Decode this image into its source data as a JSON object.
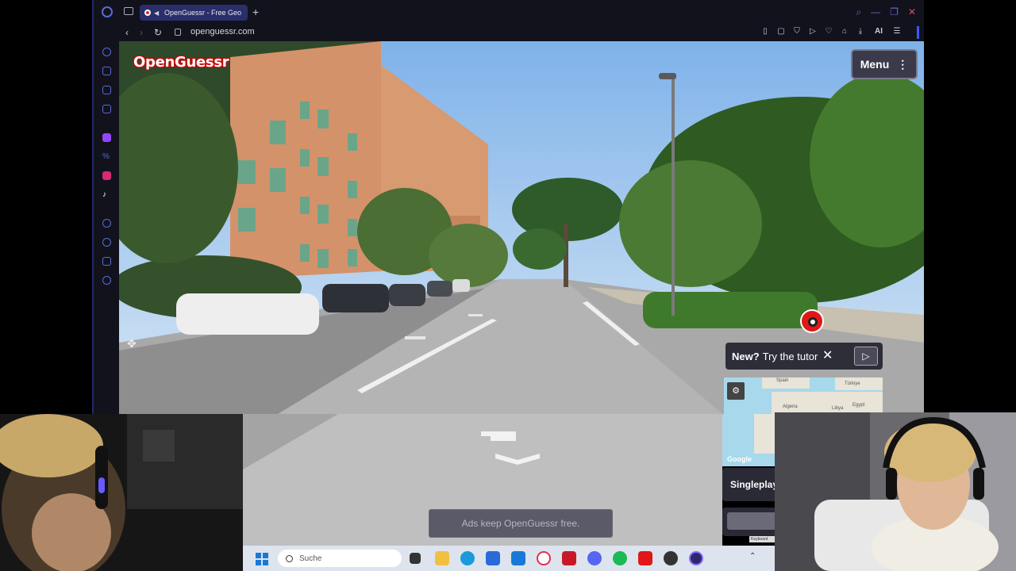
{
  "browser": {
    "tab_title": "OpenGuessr - Free Geo",
    "new_tab_label": "+",
    "url": "openguessr.com",
    "ai_label": "AI",
    "nav": {
      "back": "‹",
      "forward": "›",
      "reload": "↻"
    }
  },
  "game": {
    "logo_text": "OpenGuessr",
    "menu_label": "Menu",
    "tutorial_bold": "New?",
    "tutorial_text": "Try the tutor",
    "tutorial_close": "✕",
    "tutorial_play": "▷",
    "map_labels": [
      "Spain",
      "Türkiye",
      "Algeria",
      "Libya",
      "Egypt"
    ],
    "map_watermark": "Google",
    "mode_label": "Singleplay",
    "ads_text": "Ads keep OpenGuessr free."
  },
  "taskbar": {
    "search_placeholder": "Suche",
    "keyboard_tag": "Keyboard"
  },
  "colors": {
    "accent": "#3a5aff",
    "brand_red": "#e01818",
    "sky": "#a8cdf0"
  },
  "icons": {
    "sidebar": [
      "speed-dial-icon",
      "bag-icon",
      "vpn-icon",
      "messenger-icon",
      "twitch-icon",
      "percent-icon",
      "instagram-icon",
      "tiktok-icon",
      "player-icon",
      "history-icon",
      "extensions-icon",
      "settings-icon"
    ],
    "taskbar": [
      "start-icon",
      "task-view-icon",
      "file-explorer-icon",
      "edge-icon",
      "store-icon",
      "outlook-icon",
      "opera-gx-icon",
      "mcafee-icon",
      "discord-icon",
      "spotify-icon",
      "app-red-icon",
      "obs-icon",
      "opera-icon"
    ]
  }
}
